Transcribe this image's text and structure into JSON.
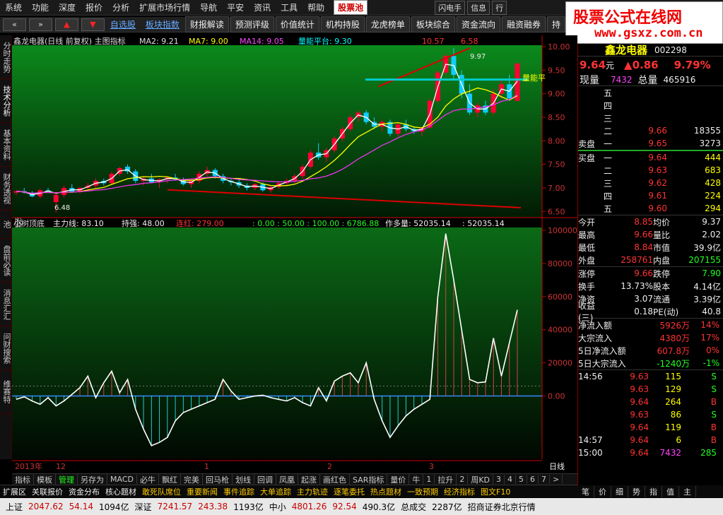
{
  "menu": {
    "items": [
      "系统",
      "功能",
      "深度",
      "报价",
      "分析",
      "扩展市场行情",
      "导航",
      "平安",
      "资讯",
      "工具",
      "帮助"
    ],
    "pool": "股票池",
    "right": [
      "闪电手",
      "信息",
      "行"
    ]
  },
  "toolbar": {
    "items": [
      "自选股",
      "板块指数",
      "财报解读",
      "预测评级",
      "价值统计",
      "机构持股",
      "龙虎榜单",
      "板块综合",
      "资金流向",
      "融资融券",
      "持"
    ]
  },
  "logo": {
    "line1": "股票公式在线网",
    "line2": "www.gsxz.com.cn"
  },
  "vtabs": [
    "分时走势",
    "技术分析",
    "基本资料",
    "财务透视",
    "股票池",
    "盘前必读",
    "消息汇汇",
    "问财搜索",
    "维赛特"
  ],
  "chart": {
    "title": "鑫龙电器(日线 前复权) 主图指标",
    "ma2": "MA2: 9.21",
    "ma7": "MA7: 9.00",
    "ma14": "MA14: 9.05",
    "vol_plat": "量能平台: 9.30",
    "top1": "10.57",
    "top2": "6.58",
    "ymain": [
      "10.00",
      "9.50",
      "9.00",
      "8.50",
      "8.00",
      "7.50",
      "7.00",
      "6.50"
    ],
    "low_label": "6.48",
    "high_label": "9.97",
    "plat_side": "量能平",
    "sub_title": "小树顶底",
    "sub_main": "主力线: 83.10",
    "sub_hold": "持强: 48.00",
    "sub_red": "连红: 279.00",
    "sub_vals": ": 0.00 : 50.00 : 100.00 : 6786.88",
    "sub_more": "作多量: 52035.14",
    "sub_more2": ": 52035.14",
    "ysub": [
      "100000",
      "80000",
      "60000",
      "40000",
      "20000",
      "0.00"
    ],
    "dates": [
      "2013年",
      "12",
      "1",
      "2",
      "3"
    ],
    "period": "日线"
  },
  "chart_data": {
    "type": "candlestick",
    "candles": [
      [
        6.9,
        6.95,
        6.85,
        6.93
      ],
      [
        6.93,
        7.0,
        6.88,
        6.9
      ],
      [
        6.9,
        6.93,
        6.8,
        6.82
      ],
      [
        6.82,
        6.98,
        6.78,
        6.95
      ],
      [
        6.95,
        7.0,
        6.9,
        6.92
      ],
      [
        6.7,
        6.9,
        6.48,
        6.85
      ],
      [
        6.85,
        7.05,
        6.8,
        7.0
      ],
      [
        7.0,
        7.08,
        6.9,
        6.92
      ],
      [
        6.92,
        7.02,
        6.88,
        7.0
      ],
      [
        7.0,
        7.1,
        6.95,
        7.05
      ],
      [
        7.05,
        7.2,
        7.0,
        7.15
      ],
      [
        7.15,
        7.2,
        7.05,
        7.1
      ],
      [
        7.1,
        7.35,
        7.08,
        7.3
      ],
      [
        7.3,
        7.45,
        7.25,
        7.42
      ],
      [
        7.45,
        7.5,
        7.3,
        7.35
      ],
      [
        7.35,
        7.4,
        7.1,
        7.15
      ],
      [
        7.15,
        7.25,
        7.05,
        7.2
      ],
      [
        7.2,
        7.3,
        7.1,
        7.12
      ],
      [
        7.12,
        7.2,
        7.0,
        7.18
      ],
      [
        7.18,
        7.25,
        7.1,
        7.22
      ],
      [
        7.22,
        7.3,
        7.15,
        7.18
      ],
      [
        7.18,
        7.22,
        7.05,
        7.08
      ],
      [
        7.08,
        7.2,
        7.0,
        7.15
      ],
      [
        7.15,
        7.35,
        7.1,
        7.3
      ],
      [
        7.3,
        7.45,
        7.25,
        7.38
      ],
      [
        7.38,
        7.42,
        7.2,
        7.25
      ],
      [
        7.25,
        7.3,
        7.1,
        7.15
      ],
      [
        7.15,
        7.2,
        7.05,
        7.12
      ],
      [
        7.12,
        7.18,
        7.0,
        7.05
      ],
      [
        7.05,
        7.1,
        6.95,
        7.0
      ],
      [
        7.0,
        7.1,
        6.95,
        7.08
      ],
      [
        7.08,
        7.12,
        6.92,
        6.95
      ],
      [
        6.95,
        7.05,
        6.9,
        7.02
      ],
      [
        7.02,
        7.15,
        6.98,
        7.1
      ],
      [
        7.1,
        7.2,
        7.05,
        7.15
      ],
      [
        7.15,
        7.3,
        7.1,
        7.25
      ],
      [
        7.25,
        7.5,
        7.2,
        7.45
      ],
      [
        7.45,
        7.8,
        7.4,
        7.75
      ],
      [
        7.75,
        7.95,
        7.6,
        7.65
      ],
      [
        7.65,
        7.85,
        7.55,
        7.8
      ],
      [
        7.8,
        8.1,
        7.75,
        8.05
      ],
      [
        8.05,
        8.3,
        8.0,
        8.25
      ],
      [
        8.25,
        8.55,
        8.2,
        8.5
      ],
      [
        8.5,
        8.65,
        8.4,
        8.6
      ],
      [
        8.6,
        8.65,
        8.35,
        8.4
      ],
      [
        8.4,
        8.5,
        8.25,
        8.3
      ],
      [
        8.3,
        8.45,
        8.2,
        8.4
      ],
      [
        8.4,
        8.45,
        8.1,
        8.15
      ],
      [
        8.15,
        8.4,
        8.1,
        8.35
      ],
      [
        8.35,
        8.45,
        8.2,
        8.25
      ],
      [
        8.25,
        8.3,
        8.15,
        8.2
      ],
      [
        8.2,
        8.3,
        8.1,
        8.28
      ],
      [
        8.28,
        8.9,
        8.25,
        8.85
      ],
      [
        8.85,
        9.5,
        8.8,
        9.45
      ],
      [
        9.45,
        9.85,
        9.4,
        9.8
      ],
      [
        9.8,
        9.97,
        9.3,
        9.4
      ],
      [
        9.4,
        9.5,
        8.9,
        9.0
      ],
      [
        9.0,
        9.2,
        8.55,
        8.6
      ],
      [
        8.6,
        8.8,
        8.5,
        8.75
      ],
      [
        8.75,
        8.85,
        8.55,
        8.6
      ],
      [
        8.6,
        9.1,
        8.55,
        9.0
      ],
      [
        9.0,
        9.3,
        8.9,
        9.2
      ],
      [
        9.2,
        9.4,
        8.85,
        8.9
      ],
      [
        8.85,
        9.66,
        8.84,
        9.64
      ]
    ],
    "ylim": [
      6.4,
      10.0
    ],
    "sub_values": [
      -2000,
      -500,
      -3000,
      -5000,
      -1000,
      -6000,
      -3000,
      1000,
      5000,
      12000,
      -1000,
      8000,
      15000,
      2000,
      10000,
      -8000,
      -20000,
      -30000,
      -28000,
      -25000,
      -15000,
      -10000,
      -8000,
      -6000,
      -4000,
      -2000,
      10000,
      3000,
      -2000,
      -1000,
      0,
      500,
      -1000,
      -2000,
      -3000,
      -1000,
      -4000,
      -6000,
      5000,
      -3000,
      9000,
      12000,
      14000,
      8000,
      20000,
      -2000,
      -15000,
      -25000,
      -18000,
      -12000,
      -8000,
      -5000,
      -2000,
      60000,
      98000,
      70000,
      40000,
      10000,
      8000,
      8500,
      35000,
      12000,
      32000,
      52000
    ],
    "sub_ylim": [
      -36000,
      100000
    ]
  },
  "sidebar": {
    "name": "鑫龙电器",
    "code": "002298",
    "price": "9.64",
    "yuan": "元",
    "chg": "▲0.86",
    "pct": "9.79%",
    "xianliang_l": "现量",
    "xianliang": "7432",
    "zongliang_l": "总量",
    "zongliang": "465916",
    "asks": [
      {
        "l": "五",
        "p": "",
        "v": ""
      },
      {
        "l": "四",
        "p": "",
        "v": ""
      },
      {
        "l": "三",
        "p": "",
        "v": ""
      },
      {
        "l": "二",
        "p": "9.66",
        "v": "18355"
      },
      {
        "l": "一",
        "p": "9.65",
        "v": "3273"
      }
    ],
    "sell_l": "卖盘",
    "buy_l": "买盘",
    "bids": [
      {
        "l": "一",
        "p": "9.64",
        "v": "444"
      },
      {
        "l": "二",
        "p": "9.63",
        "v": "683"
      },
      {
        "l": "三",
        "p": "9.62",
        "v": "428"
      },
      {
        "l": "四",
        "p": "9.61",
        "v": "224"
      },
      {
        "l": "五",
        "p": "9.60",
        "v": "294"
      }
    ],
    "stats": [
      [
        "今开",
        "8.85",
        "均价",
        "9.37"
      ],
      [
        "最高",
        "9.66",
        "量比",
        "2.02"
      ],
      [
        "最低",
        "8.84",
        "市值",
        "39.9亿"
      ],
      [
        "外盘",
        "258761",
        "内盘",
        "207155"
      ]
    ],
    "stats2": [
      [
        "涨停",
        "9.66",
        "跌停",
        "7.90"
      ],
      [
        "换手",
        "13.73%",
        "股本",
        "4.14亿"
      ],
      [
        "净资",
        "3.07",
        "流通",
        "3.39亿"
      ],
      [
        "收益(三)",
        "0.18",
        "PE(动)",
        "40.8"
      ]
    ],
    "flows": [
      [
        "净流入额",
        "5926万",
        "14%"
      ],
      [
        "大宗流入",
        "4380万",
        "17%"
      ],
      [
        "5日净流入额",
        "607.8万",
        "0%"
      ],
      [
        "5日大宗流入",
        "-1240万",
        "-1%"
      ]
    ],
    "ticks": [
      [
        "14:56",
        "9.63",
        "115",
        "S"
      ],
      [
        "",
        "9.63",
        "129",
        "S"
      ],
      [
        "",
        "9.64",
        "264",
        "B"
      ],
      [
        "",
        "9.63",
        "86",
        "S"
      ],
      [
        "",
        "9.64",
        "119",
        "B"
      ],
      [
        "14:57",
        "9.64",
        "6",
        "B"
      ],
      [
        "15:00",
        "9.64",
        "7432",
        "285"
      ]
    ],
    "tabs": [
      "笔",
      "价",
      "细",
      "势",
      "指",
      "值",
      "主"
    ]
  },
  "tabs1": [
    "指标",
    "模板",
    "管理",
    "另存为",
    "MACD",
    "必牛",
    "飘红",
    "完美",
    "回马枪",
    "划线",
    "回调",
    "凤凰",
    "起涨",
    "画红色",
    "SAR指标",
    "量价",
    "牛",
    "1",
    "拉升",
    "2",
    "周KD",
    "3",
    "4",
    "5",
    "6",
    "7",
    ">"
  ],
  "tabs2": [
    "扩展区",
    "关联报价",
    "资金分布",
    "核心题材",
    "敢死队席位",
    "重要新闻",
    "事件追踪",
    "大单追踪",
    "主力轨迹",
    "逐笔委托",
    "热点题材",
    "一致预期",
    "经济指标",
    "图文F10"
  ],
  "status": {
    "sh": "上证",
    "shv": "2047.62",
    "shc": "54.14",
    "sha": "1094亿",
    "sz": "深证",
    "szv": "7241.57",
    "szc": "243.38",
    "sza": "1193亿",
    "zx": "中小",
    "zxv": "4801.26",
    "zxc": "92.54",
    "zxa": "490.3亿",
    "total": "总成交",
    "totalv": "2287亿",
    "broker": "招商证券北京行情"
  }
}
